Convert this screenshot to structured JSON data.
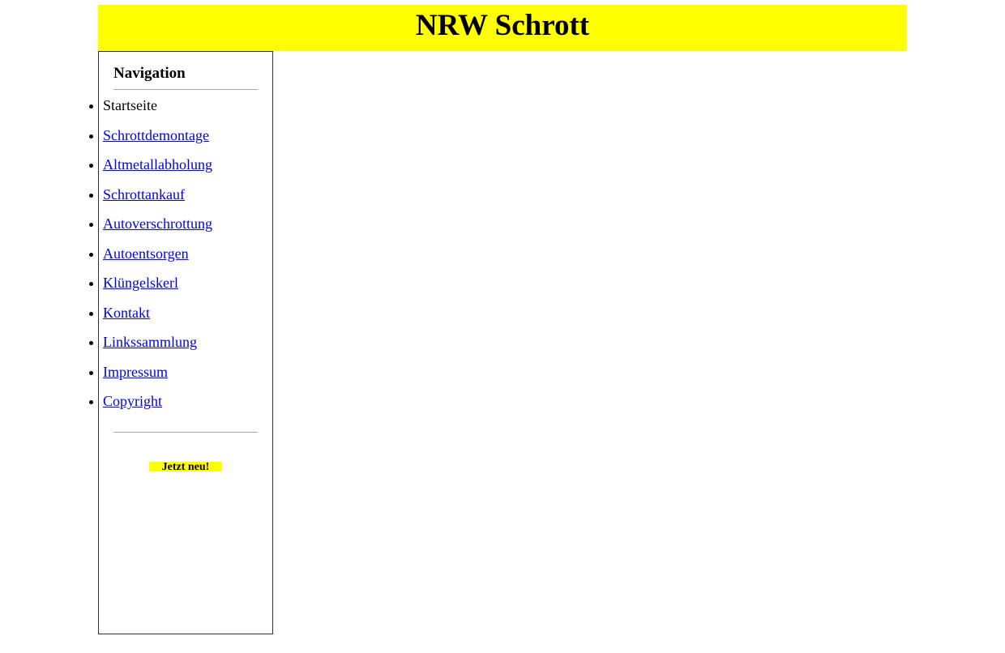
{
  "header": {
    "title": "NRW Schrott"
  },
  "sidebar": {
    "heading": "Navigation",
    "items": [
      {
        "label": "Startseite",
        "current": true
      },
      {
        "label": "Schrottdemontage",
        "current": false
      },
      {
        "label": "Altmetallabholung",
        "current": false
      },
      {
        "label": "Schrottankauf",
        "current": false
      },
      {
        "label": "Autoverschrottung",
        "current": false
      },
      {
        "label": "Autoentsorgen",
        "current": false
      },
      {
        "label": "Klüngelskerl",
        "current": false
      },
      {
        "label": "Kontakt",
        "current": false
      },
      {
        "label": "Linkssammlung",
        "current": false
      },
      {
        "label": "Impressum",
        "current": false
      },
      {
        "label": "Copyright",
        "current": false
      }
    ],
    "badge_text": "Jetzt neu!"
  },
  "colors": {
    "accent": "#ffff00",
    "link": "#0000ee"
  }
}
